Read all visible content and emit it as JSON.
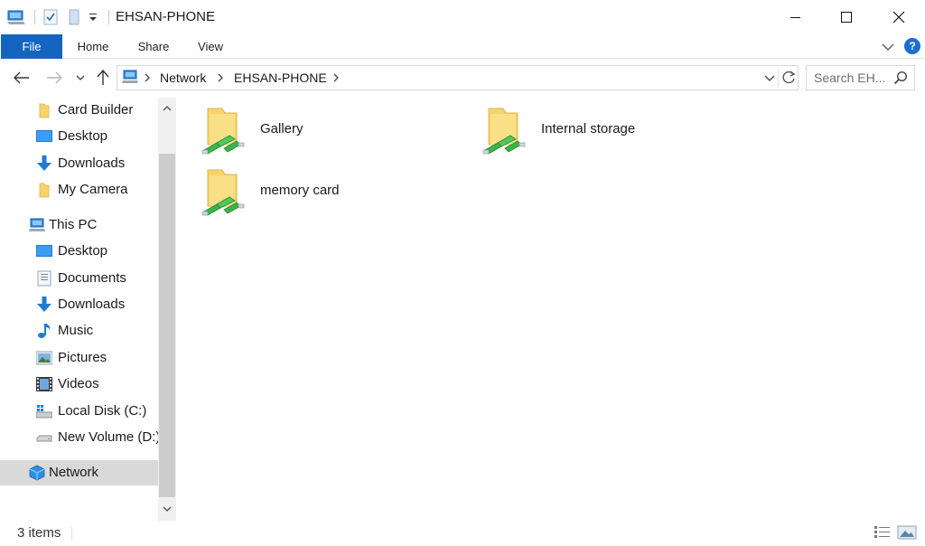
{
  "window": {
    "title": "EHSAN-PHONE"
  },
  "ribbon": {
    "tabs": [
      "File",
      "Home",
      "Share",
      "View"
    ],
    "help_label": "?"
  },
  "address": {
    "breadcrumbs": [
      "Network",
      "EHSAN-PHONE"
    ]
  },
  "search": {
    "placeholder": "Search EH..."
  },
  "nav_pane": {
    "quick_access": [
      {
        "label": "Card Builder",
        "icon": "folder-icon"
      },
      {
        "label": "Desktop",
        "icon": "desktop-icon"
      },
      {
        "label": "Downloads",
        "icon": "downloads-icon"
      },
      {
        "label": "My Camera",
        "icon": "folder-icon"
      }
    ],
    "this_pc": {
      "label": "This PC",
      "icon": "pc-icon"
    },
    "this_pc_items": [
      {
        "label": "Desktop",
        "icon": "desktop-icon"
      },
      {
        "label": "Documents",
        "icon": "documents-icon"
      },
      {
        "label": "Downloads",
        "icon": "downloads-icon"
      },
      {
        "label": "Music",
        "icon": "music-icon"
      },
      {
        "label": "Pictures",
        "icon": "pictures-icon"
      },
      {
        "label": "Videos",
        "icon": "videos-icon"
      },
      {
        "label": "Local Disk (C:)",
        "icon": "local-disk-icon"
      },
      {
        "label": "New Volume (D:)",
        "icon": "drive-icon"
      }
    ],
    "network": {
      "label": "Network",
      "icon": "network-icon",
      "selected": true
    }
  },
  "content": {
    "items": [
      {
        "label": "Gallery",
        "icon": "shared-folder-icon"
      },
      {
        "label": "Internal storage",
        "icon": "shared-folder-icon"
      },
      {
        "label": "memory card",
        "icon": "shared-folder-icon"
      }
    ]
  },
  "status": {
    "item_count": "3 items"
  },
  "colors": {
    "accent": "#1565c0",
    "selected_bg": "#d9d9d9",
    "folder_yellow": "#f6d36b",
    "share_green": "#3bb54a"
  }
}
